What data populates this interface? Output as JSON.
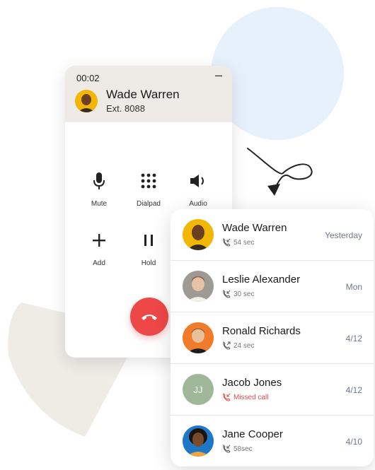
{
  "call": {
    "timer": "00:02",
    "minimize_label": "–",
    "caller_name": "Wade Warren",
    "caller_ext": "Ext. 8088",
    "controls": [
      {
        "label": "Mute",
        "icon": "microphone-icon"
      },
      {
        "label": "Dialpad",
        "icon": "dialpad-icon"
      },
      {
        "label": "Audio",
        "icon": "speaker-icon"
      },
      {
        "label": "Add",
        "icon": "plus-icon"
      },
      {
        "label": "Hold",
        "icon": "pause-icon"
      }
    ],
    "end_icon": "end-call-icon",
    "end_color": "#ee4747"
  },
  "history": [
    {
      "name": "Wade Warren",
      "detail": "54 sec",
      "date": "Yesterday",
      "kind": "incoming",
      "avatar_color": "#f2b705"
    },
    {
      "name": "Leslie Alexander",
      "detail": "30 sec",
      "date": "Mon",
      "kind": "incoming",
      "avatar_color": "#b9b2ab"
    },
    {
      "name": "Ronald Richards",
      "detail": "24 sec",
      "date": "4/12",
      "kind": "outgoing",
      "avatar_color": "#f07b2a"
    },
    {
      "name": "Jacob Jones",
      "initials": "JJ",
      "detail": "Missed call",
      "date": "4/12",
      "kind": "missed",
      "avatar_color": "#9fb89a"
    },
    {
      "name": "Jane Cooper",
      "detail": "58sec",
      "date": "4/10",
      "kind": "incoming",
      "avatar_color": "#1f77c8"
    }
  ],
  "colors": {
    "accent_blue": "#e7f1fc",
    "fan": "#efece6",
    "missed": "#e24a4a"
  }
}
